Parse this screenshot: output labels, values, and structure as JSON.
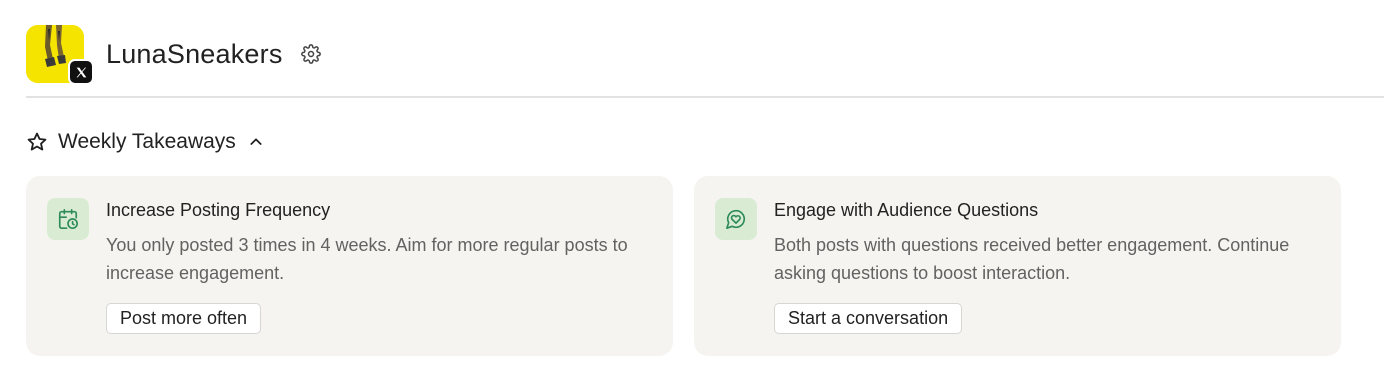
{
  "header": {
    "brand_name": "LunaSneakers",
    "avatar_icon": "sneaker-photo-avatar",
    "platform_badge_icon": "x-logo-icon",
    "settings_icon": "gear-icon"
  },
  "section": {
    "title": "Weekly Takeaways",
    "icon": "star-icon",
    "toggle_icon": "chevron-up-icon",
    "expanded": true
  },
  "cards": [
    {
      "icon": "calendar-clock-icon",
      "title": "Increase Posting Frequency",
      "description": "You only posted 3 times in 4 weeks. Aim for more regular posts to increase engagement.",
      "action_label": "Post more often"
    },
    {
      "icon": "chat-heart-icon",
      "title": "Engage with Audience Questions",
      "description": "Both posts with questions received better engagement. Continue asking questions to boost interaction.",
      "action_label": "Start a conversation"
    }
  ],
  "colors": {
    "accent_green_bg": "#d9ecd3",
    "accent_green_icon": "#2e8b57",
    "card_bg": "#f5f4f0",
    "avatar_yellow": "#f5e400"
  }
}
